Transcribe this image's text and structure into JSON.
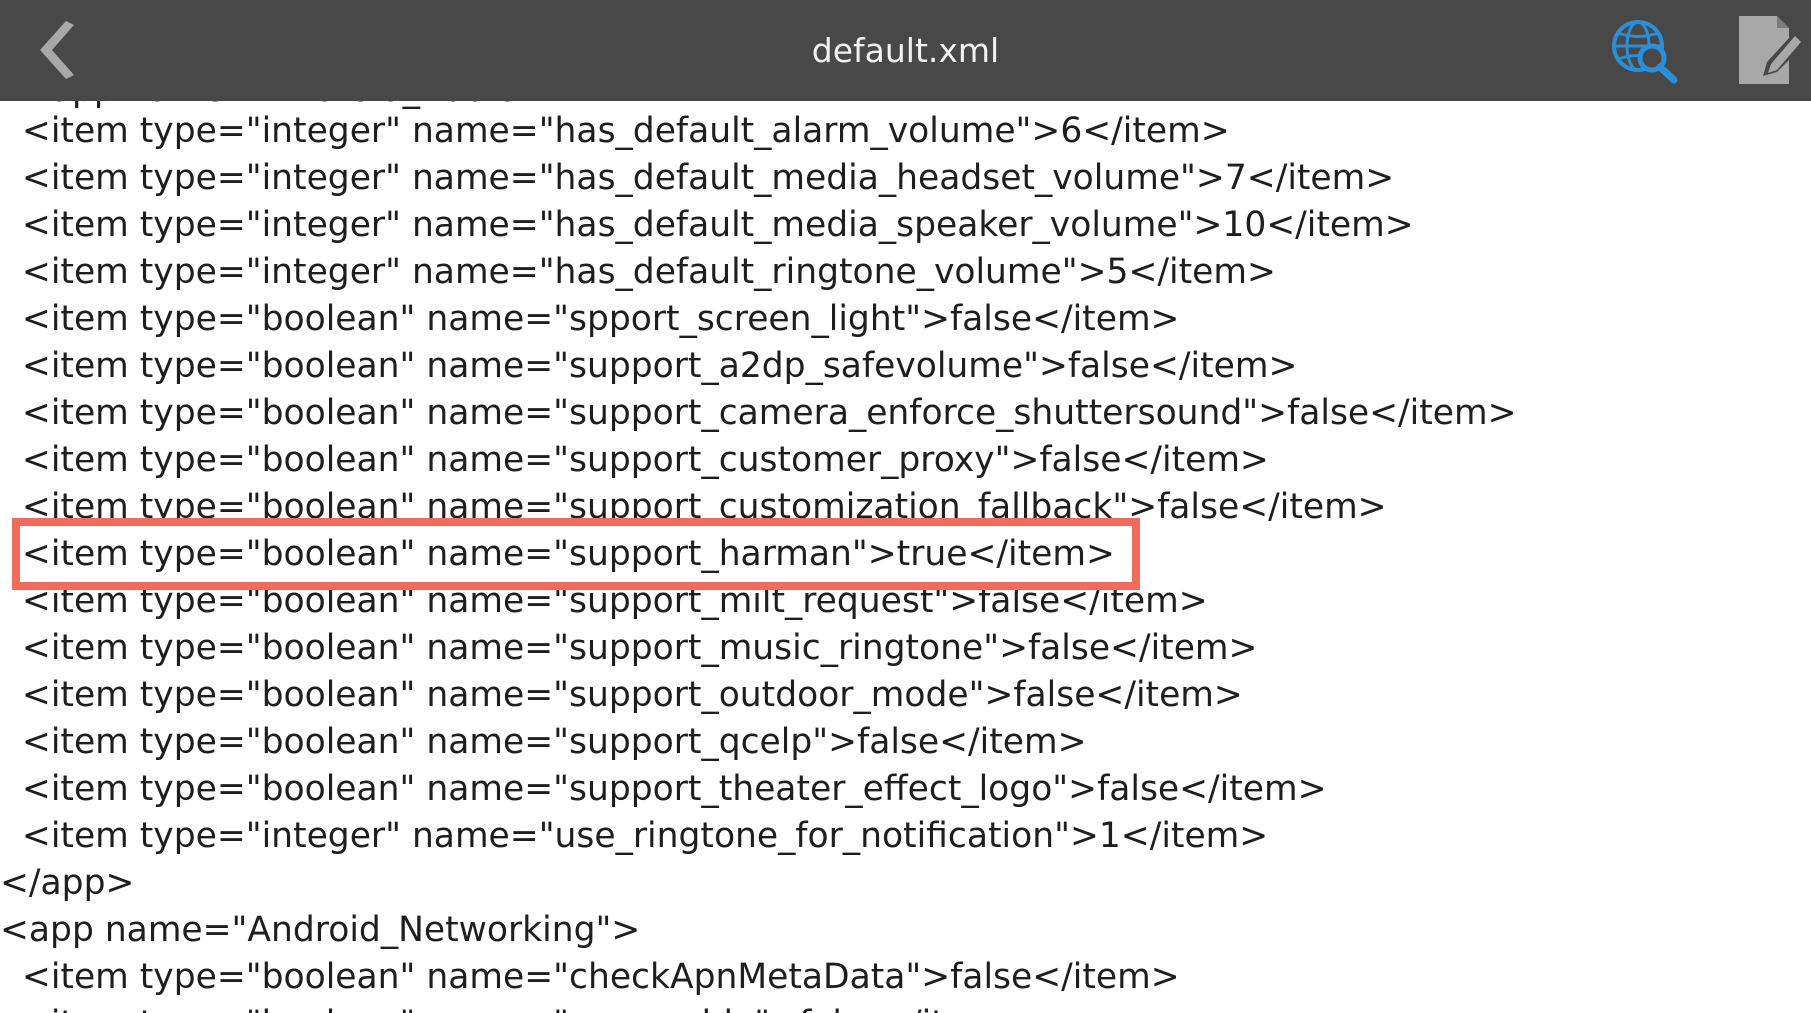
{
  "app": {
    "title": "default.xml",
    "icons": {
      "back": "chevron-left-icon",
      "search_web": "globe-search-icon",
      "edit": "edit-document-icon"
    },
    "colors": {
      "action_bar": "#484848",
      "title_text": "#f2f2f2",
      "accent_icon": "#2a8fd8",
      "highlight": "#f26b5b",
      "code_text": "#1e1e1e"
    }
  },
  "code": {
    "lines": [
      "  <app name=\"Android_Audio\">",
      "  <item type=\"integer\" name=\"has_default_alarm_volume\">6</item>",
      "  <item type=\"integer\" name=\"has_default_media_headset_volume\">7</item>",
      "  <item type=\"integer\" name=\"has_default_media_speaker_volume\">10</item>",
      "  <item type=\"integer\" name=\"has_default_ringtone_volume\">5</item>",
      "  <item type=\"boolean\" name=\"spport_screen_light\">false</item>",
      "  <item type=\"boolean\" name=\"support_a2dp_safevolume\">false</item>",
      "  <item type=\"boolean\" name=\"support_camera_enforce_shuttersound\">false</item>",
      "  <item type=\"boolean\" name=\"support_customer_proxy\">false</item>",
      "  <item type=\"boolean\" name=\"support_customization_fallback\">false</item>",
      "  <item type=\"boolean\" name=\"support_harman\">true</item>",
      "  <item type=\"boolean\" name=\"support_milt_request\">false</item>",
      "  <item type=\"boolean\" name=\"support_music_ringtone\">false</item>",
      "  <item type=\"boolean\" name=\"support_outdoor_mode\">false</item>",
      "  <item type=\"boolean\" name=\"support_qcelp\">false</item>",
      "  <item type=\"boolean\" name=\"support_theater_effect_logo\">false</item>",
      "  <item type=\"integer\" name=\"use_ringtone_for_notification\">1</item>",
      "</app>",
      "<app name=\"Android_Networking\">",
      "  <item type=\"boolean\" name=\"checkApnMetaData\">false</item>",
      "  <item type=\"boolean\" name=\"csr_enable\">false</item>"
    ],
    "highlighted_line": 10
  }
}
